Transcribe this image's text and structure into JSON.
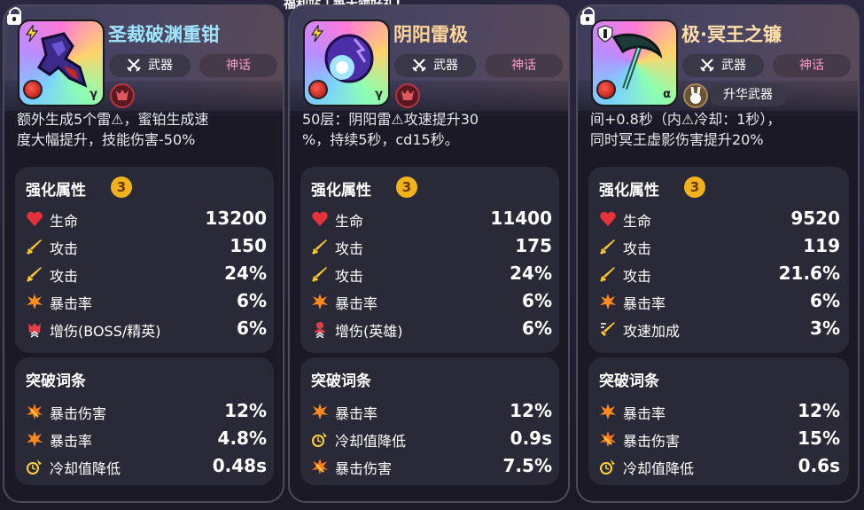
{
  "top_banner": "福利站丁每天领好礼!",
  "colors": {
    "card_bg": "#1a1925",
    "panel_bg": "#2a2937",
    "badge": "#f2b21c",
    "myth_text": "#ff9ac2"
  },
  "cards": [
    {
      "title": "圣裁破渊重钳",
      "type_label": "武器",
      "rarity_label": "神话",
      "corner_letter": "γ",
      "icon_name": "heavy-pincer-weapon-icon",
      "emblem_name": "red-demon-emblem-icon",
      "desc": "额外生成5个雷⚠，蜜铂生成速\n度大幅提升，技能伤害-50%",
      "enhance": {
        "title": "强化属性",
        "badge": "3",
        "rows": [
          {
            "icon": "heart-icon",
            "label": "生命",
            "value": "13200"
          },
          {
            "icon": "sword-icon",
            "label": "攻击",
            "value": "150"
          },
          {
            "icon": "sword-icon",
            "label": "攻击",
            "value": "24%"
          },
          {
            "icon": "crit-burst-icon",
            "label": "暴击率",
            "value": "6%"
          },
          {
            "icon": "boss-damage-icon",
            "label": "增伤(BOSS/精英)",
            "value": "6%"
          }
        ]
      },
      "breakthrough": {
        "title": "突破词条",
        "rows": [
          {
            "icon": "crit-damage-icon",
            "label": "暴击伤害",
            "value": "12%"
          },
          {
            "icon": "crit-burst-icon",
            "label": "暴击率",
            "value": "4.8%"
          },
          {
            "icon": "cooldown-icon",
            "label": "冷却值降低",
            "value": "0.48s"
          }
        ]
      }
    },
    {
      "title": "阴阳雷极",
      "type_label": "武器",
      "rarity_label": "神话",
      "corner_letter": "γ",
      "icon_name": "thunder-orb-weapon-icon",
      "emblem_name": "red-demon-emblem-icon",
      "desc": "50层：阴阳雷⚠攻速提升30\n%，持续5秒，cd15秒。",
      "enhance": {
        "title": "强化属性",
        "badge": "3",
        "rows": [
          {
            "icon": "heart-icon",
            "label": "生命",
            "value": "11400"
          },
          {
            "icon": "sword-icon",
            "label": "攻击",
            "value": "175"
          },
          {
            "icon": "sword-icon",
            "label": "攻击",
            "value": "24%"
          },
          {
            "icon": "crit-burst-icon",
            "label": "暴击率",
            "value": "6%"
          },
          {
            "icon": "hero-damage-icon",
            "label": "增伤(英雄)",
            "value": "6%"
          }
        ]
      },
      "breakthrough": {
        "title": "突破词条",
        "rows": [
          {
            "icon": "crit-burst-icon",
            "label": "暴击率",
            "value": "12%"
          },
          {
            "icon": "cooldown-icon",
            "label": "冷却值降低",
            "value": "0.9s"
          },
          {
            "icon": "crit-damage-icon",
            "label": "暴击伤害",
            "value": "7.5%"
          }
        ]
      }
    },
    {
      "title": "极·冥王之镰",
      "type_label": "武器",
      "rarity_label": "神话",
      "corner_letter": "α",
      "icon_name": "underworld-scythe-weapon-icon",
      "emblem_name": "rabbit-emblem-icon",
      "upgrade_label": "升华武器",
      "desc": "间+0.8秒（内⚠冷却：1秒），\n同时冥王虚影伤害提升20%",
      "enhance": {
        "title": "强化属性",
        "badge": "3",
        "rows": [
          {
            "icon": "heart-icon",
            "label": "生命",
            "value": "9520"
          },
          {
            "icon": "sword-icon",
            "label": "攻击",
            "value": "119"
          },
          {
            "icon": "sword-icon",
            "label": "攻击",
            "value": "21.6%"
          },
          {
            "icon": "crit-burst-icon",
            "label": "暴击率",
            "value": "6%"
          },
          {
            "icon": "attack-speed-icon",
            "label": "攻速加成",
            "value": "3%"
          }
        ]
      },
      "breakthrough": {
        "title": "突破词条",
        "rows": [
          {
            "icon": "crit-burst-icon",
            "label": "暴击率",
            "value": "12%"
          },
          {
            "icon": "crit-damage-icon",
            "label": "暴击伤害",
            "value": "15%"
          },
          {
            "icon": "cooldown-icon",
            "label": "冷却值降低",
            "value": "0.6s"
          }
        ]
      }
    }
  ]
}
